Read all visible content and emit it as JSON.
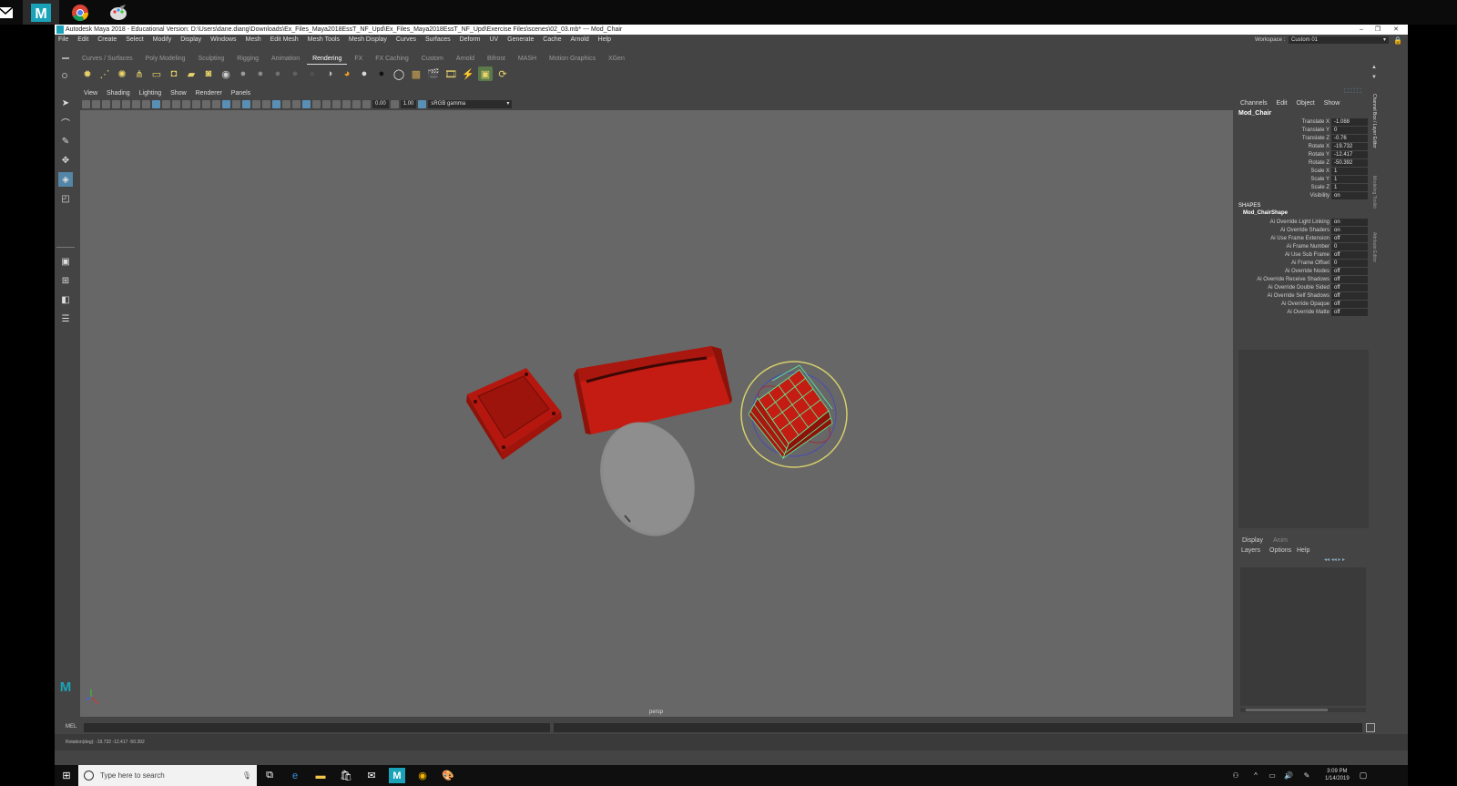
{
  "taskbar_top": {
    "apps": [
      "maya-app-icon",
      "chrome-app-icon",
      "paint-app-icon"
    ]
  },
  "window": {
    "title": "Autodesk Maya 2018 - Educational Version: D:\\Users\\dane.diang\\Downloads\\Ex_Files_Maya2018EssT_NF_Upd\\Ex_Files_Maya2018EssT_NF_Upd\\Exercise Files\\scenes\\02_03.mb* --- Mod_Chair",
    "menus": [
      "File",
      "Edit",
      "Create",
      "Select",
      "Modify",
      "Display",
      "Windows",
      "Mesh",
      "Edit Mesh",
      "Mesh Tools",
      "Mesh Display",
      "Curves",
      "Surfaces",
      "Deform",
      "UV",
      "Generate",
      "Cache",
      "Arnold",
      "Help"
    ],
    "workspace_label": "Workspace :",
    "workspace_value": "Custom 01"
  },
  "shelf": {
    "tabs": [
      "Curves / Surfaces",
      "Poly Modeling",
      "Sculpting",
      "Rigging",
      "Animation",
      "Rendering",
      "FX",
      "FX Caching",
      "Custom",
      "Arnold",
      "Bifrost",
      "MASH",
      "Motion Graphics",
      "XGen"
    ],
    "active_tab": "Rendering"
  },
  "panel": {
    "menus": [
      "View",
      "Shading",
      "Lighting",
      "Show",
      "Renderer",
      "Panels"
    ],
    "exposure": "0.00",
    "gamma": "1.00",
    "colorspace": "sRGB gamma",
    "camera_label": "persp"
  },
  "channelbox": {
    "menus": [
      "Channels",
      "Edit",
      "Object",
      "Show"
    ],
    "object_name": "Mod_Chair",
    "transform": [
      {
        "label": "Translate X",
        "value": "-1.088"
      },
      {
        "label": "Translate Y",
        "value": "0"
      },
      {
        "label": "Translate Z",
        "value": "-0.76"
      },
      {
        "label": "Rotate X",
        "value": "-19.732"
      },
      {
        "label": "Rotate Y",
        "value": "-12.417"
      },
      {
        "label": "Rotate Z",
        "value": "-50.392"
      },
      {
        "label": "Scale X",
        "value": "1"
      },
      {
        "label": "Scale Y",
        "value": "1"
      },
      {
        "label": "Scale Z",
        "value": "1"
      },
      {
        "label": "Visibility",
        "value": "on"
      }
    ],
    "shapes_header": "SHAPES",
    "shape_name": "Mod_ChairShape",
    "shape_attrs": [
      {
        "label": "Ai Override Light Linking",
        "value": "on"
      },
      {
        "label": "Ai Override Shaders",
        "value": "on"
      },
      {
        "label": "Ai Use Frame Extension",
        "value": "off"
      },
      {
        "label": "Ai Frame Number",
        "value": "0"
      },
      {
        "label": "Ai Use Sub Frame",
        "value": "off"
      },
      {
        "label": "Ai Frame Offset",
        "value": "0"
      },
      {
        "label": "Ai Override Nodes",
        "value": "off"
      },
      {
        "label": "Ai Override Receive Shadows",
        "value": "off"
      },
      {
        "label": "Ai Override Double Sided",
        "value": "off"
      },
      {
        "label": "Ai Override Self Shadows",
        "value": "off"
      },
      {
        "label": "Ai Override Opaque",
        "value": "off"
      },
      {
        "label": "Ai Override Matte",
        "value": "off"
      }
    ]
  },
  "layers": {
    "tabs": [
      "Display",
      "Anim"
    ],
    "menus": [
      "Layers",
      "Options",
      "Help"
    ]
  },
  "side_tabs": [
    "Channel Box / Layer Editor",
    "Modeling Toolkit",
    "Attribute Editor"
  ],
  "cmdline": {
    "label": "MEL"
  },
  "helpline": {
    "text": "Rotation(deg):   -19.732     -12.417     -50.392"
  },
  "win_taskbar": {
    "search_placeholder": "Type here to search",
    "time": "3:09 PM",
    "date": "1/14/2019"
  },
  "colors": {
    "accent": "#5285a6",
    "object_red": "#c41c12",
    "wire_green": "#59f09a",
    "viewport_bg": "#676767"
  }
}
